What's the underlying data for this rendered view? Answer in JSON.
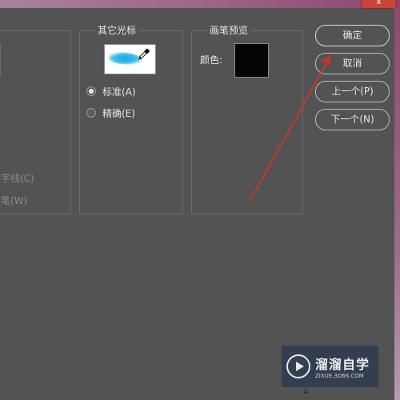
{
  "window": {
    "close_label": "x"
  },
  "left_group": {
    "options": [
      "字线(C)",
      "笔(W)"
    ]
  },
  "cursor_group": {
    "title": "其它光标",
    "preview_icon": "brush-eyedropper-icon",
    "options": [
      {
        "label": "标准(A)",
        "checked": true
      },
      {
        "label": "精确(E)",
        "checked": false
      }
    ]
  },
  "brush_group": {
    "title": "画笔预览",
    "color_label": "颜色:",
    "color_value": "#050505"
  },
  "buttons": {
    "ok": "确定",
    "cancel": "取消",
    "prev": "上一个(P)",
    "next": "下一个(N)"
  },
  "annotation": {
    "color": "#c0392b",
    "type": "arrow"
  },
  "watermark": {
    "name": "溜溜自学",
    "url": "ZIXUE.3D66.COM"
  },
  "bottom_text": "↓"
}
